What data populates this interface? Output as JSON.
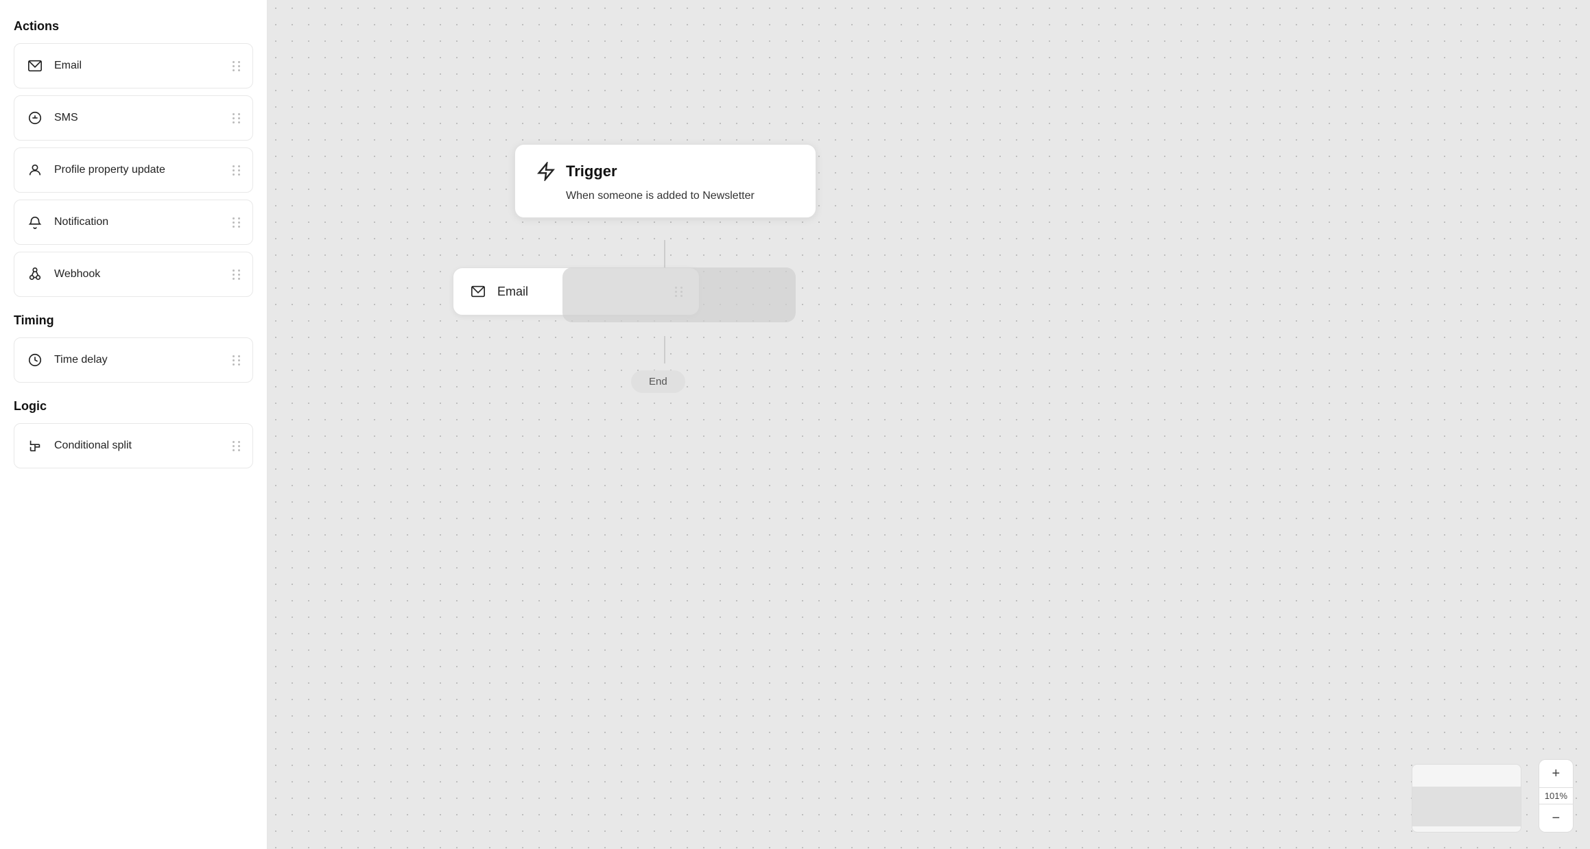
{
  "sidebar": {
    "sections": [
      {
        "id": "actions",
        "label": "Actions",
        "items": [
          {
            "id": "email",
            "label": "Email",
            "icon": "email-icon"
          },
          {
            "id": "sms",
            "label": "SMS",
            "icon": "sms-icon"
          },
          {
            "id": "profile-property-update",
            "label": "Profile property update",
            "icon": "profile-icon"
          },
          {
            "id": "notification",
            "label": "Notification",
            "icon": "notification-icon"
          },
          {
            "id": "webhook",
            "label": "Webhook",
            "icon": "webhook-icon"
          }
        ]
      },
      {
        "id": "timing",
        "label": "Timing",
        "items": [
          {
            "id": "time-delay",
            "label": "Time delay",
            "icon": "clock-icon"
          }
        ]
      },
      {
        "id": "logic",
        "label": "Logic",
        "items": [
          {
            "id": "conditional-split",
            "label": "Conditional split",
            "icon": "split-icon"
          }
        ]
      }
    ]
  },
  "canvas": {
    "trigger": {
      "title": "Trigger",
      "description": "When someone is added to Newsletter"
    },
    "email_node": {
      "label": "Email"
    },
    "end_node": {
      "label": "End"
    },
    "zoom": {
      "level": "101%",
      "plus_label": "+",
      "minus_label": "−"
    }
  }
}
